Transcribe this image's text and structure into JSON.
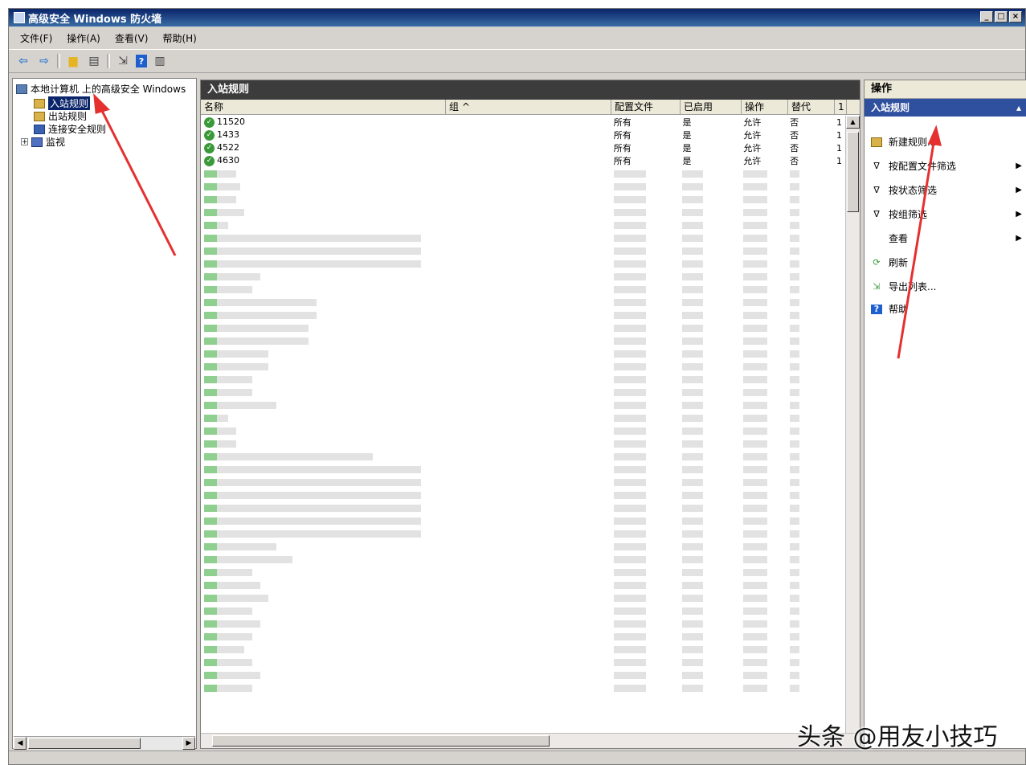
{
  "window": {
    "title": "高级安全 Windows 防火墙",
    "controls": [
      "_",
      "□",
      "×"
    ]
  },
  "menu": [
    "文件(F)",
    "操作(A)",
    "查看(V)",
    "帮助(H)"
  ],
  "tree": {
    "root": "本地计算机 上的高级安全 Windows",
    "items": [
      "入站规则",
      "出站规则",
      "连接安全规则",
      "监视"
    ]
  },
  "center": {
    "title": "入站规则",
    "columns": [
      "名称",
      "组 ^",
      "配置文件",
      "已启用",
      "操作",
      "替代",
      "1"
    ],
    "rows": [
      {
        "name": "11520",
        "group": "",
        "profile": "所有",
        "enabled": "是",
        "action": "允许",
        "override": "否",
        "extra": "1"
      },
      {
        "name": "1433",
        "group": "",
        "profile": "所有",
        "enabled": "是",
        "action": "允许",
        "override": "否",
        "extra": "1"
      },
      {
        "name": "4522",
        "group": "",
        "profile": "所有",
        "enabled": "是",
        "action": "允许",
        "override": "否",
        "extra": "1"
      },
      {
        "name": "4630",
        "group": "",
        "profile": "所有",
        "enabled": "是",
        "action": "允许",
        "override": "否",
        "extra": "1"
      }
    ],
    "blurred_row_count": 41
  },
  "actions": {
    "title": "操作",
    "section": "入站规则",
    "items": [
      {
        "label": "新建规则...",
        "icon": "new-rule-icon",
        "submenu": false
      },
      {
        "label": "按配置文件筛选",
        "icon": "filter-icon",
        "submenu": true
      },
      {
        "label": "按状态筛选",
        "icon": "filter-icon",
        "submenu": true
      },
      {
        "label": "按组筛选",
        "icon": "filter-icon",
        "submenu": true
      },
      {
        "label": "查看",
        "icon": "",
        "submenu": true
      },
      {
        "label": "刷新",
        "icon": "refresh-icon",
        "submenu": false
      },
      {
        "label": "导出列表...",
        "icon": "export-icon",
        "submenu": false
      },
      {
        "label": "帮助",
        "icon": "help-icon",
        "submenu": false
      }
    ]
  },
  "watermark": "头条 @用友小技巧",
  "colors": {
    "annotation_arrow": "#e53030",
    "section_bg": "#2f4f9f",
    "titlebar": "#0a246a"
  }
}
